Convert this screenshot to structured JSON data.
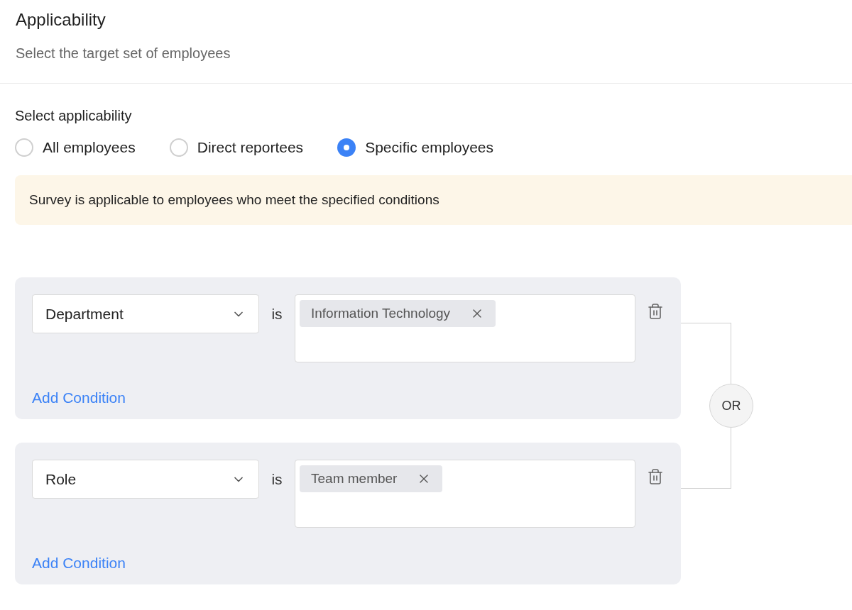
{
  "title": "Applicability",
  "subtitle": "Select the target set of employees",
  "applicability": {
    "label": "Select applicability",
    "options": [
      {
        "label": "All employees",
        "selected": false
      },
      {
        "label": "Direct reportees",
        "selected": false
      },
      {
        "label": "Specific employees",
        "selected": true
      }
    ]
  },
  "notice": "Survey is applicable to employees who meet the specified conditions",
  "rule_groups": [
    {
      "conditions": [
        {
          "field": "Department",
          "operator": "is",
          "values": [
            "Information Technology"
          ]
        }
      ],
      "add_label": "Add Condition"
    },
    {
      "conditions": [
        {
          "field": "Role",
          "operator": "is",
          "values": [
            "Team member"
          ]
        }
      ],
      "add_label": "Add Condition"
    }
  ],
  "group_connector": "OR"
}
